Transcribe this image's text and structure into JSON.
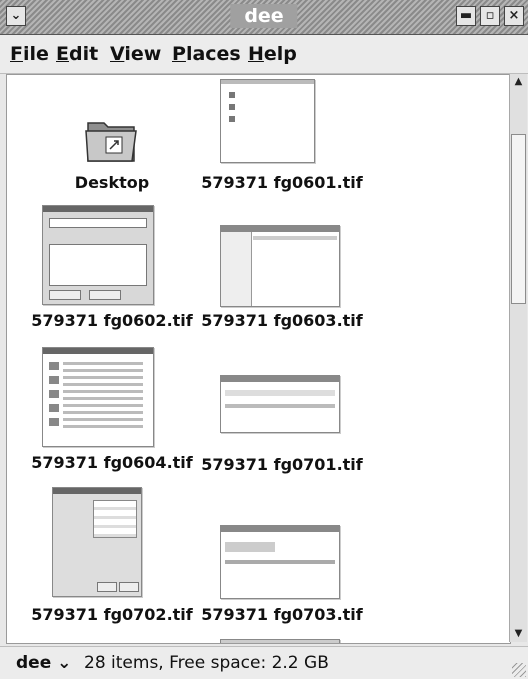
{
  "window": {
    "title": "dee",
    "menu_icon": "chevron-down-icon",
    "buttons": {
      "minimize": "▬",
      "maximize": "▫",
      "close": "×"
    }
  },
  "menu": [
    {
      "label": "ile",
      "mnemonic": "F"
    },
    {
      "label": "dit",
      "mnemonic": "E"
    },
    {
      "label": "iew",
      "mnemonic": "V"
    },
    {
      "label": "laces",
      "mnemonic": "P"
    },
    {
      "label": "elp",
      "mnemonic": "H"
    }
  ],
  "files": [
    {
      "name": "Desktop",
      "kind": "folder"
    },
    {
      "name": "579371 fg0601.tif",
      "kind": "image"
    },
    {
      "name": "579371 fg0602.tif",
      "kind": "image"
    },
    {
      "name": "579371 fg0603.tif",
      "kind": "image"
    },
    {
      "name": "579371 fg0604.tif",
      "kind": "image"
    },
    {
      "name": "579371 fg0701.tif",
      "kind": "image"
    },
    {
      "name": "579371 fg0702.tif",
      "kind": "image"
    },
    {
      "name": "579371 fg0703.tif",
      "kind": "image"
    }
  ],
  "statusbar": {
    "location": "dee ⌄",
    "info": "28 items, Free space: 2.2 GB"
  },
  "colors": {
    "content_bg": "#ffffff",
    "chrome": "#ececec"
  }
}
